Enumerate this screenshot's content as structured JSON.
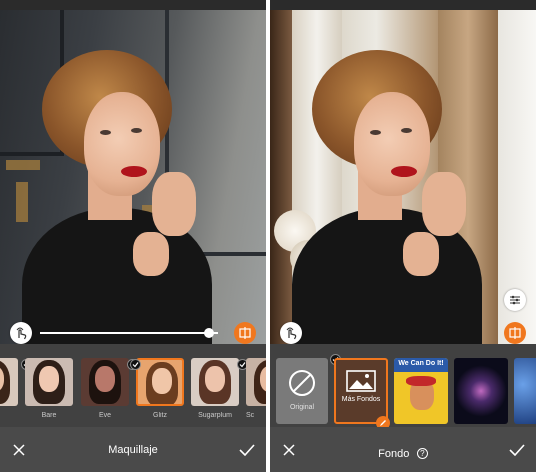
{
  "left_panel": {
    "title": "Maquillaje",
    "slider_level": 0.95,
    "presets": [
      {
        "label": "",
        "selected": false
      },
      {
        "label": "Bare",
        "selected": false
      },
      {
        "label": "Eve",
        "selected": false
      },
      {
        "label": "Glitz",
        "selected": true
      },
      {
        "label": "Sugarplum",
        "selected": false
      },
      {
        "label": "Sc",
        "selected": false
      }
    ]
  },
  "right_panel": {
    "title": "Fondo",
    "info_glyph": "?",
    "backgrounds": [
      {
        "label": "Original",
        "selected": false
      },
      {
        "label": "Más Fondos",
        "selected": true
      },
      {
        "label": "We Can Do It!",
        "selected": false
      },
      {
        "label": "",
        "selected": false
      },
      {
        "label": "",
        "selected": false
      }
    ]
  },
  "colors": {
    "accent": "#f0771e",
    "bar_bg": "#4a4a4a",
    "strip_bg": "#414141",
    "chrome": "#2b2b2b"
  },
  "icons": [
    "close-icon",
    "check-icon",
    "compare-hand-icon",
    "split-view-icon",
    "adjust-sliders-icon",
    "edit-pencil-icon",
    "image-placeholder-icon",
    "no-background-icon",
    "info-icon"
  ]
}
